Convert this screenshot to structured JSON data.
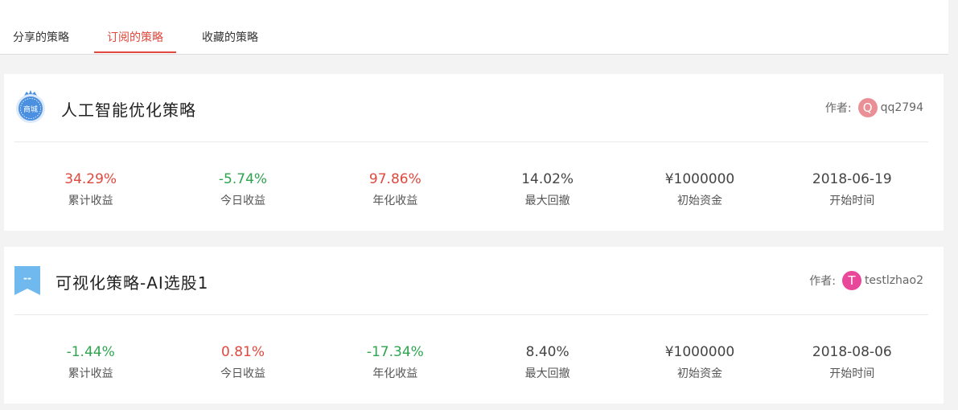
{
  "tabs": [
    {
      "label": "分享的策略",
      "active": false
    },
    {
      "label": "订阅的策略",
      "active": true
    },
    {
      "label": "收藏的策略",
      "active": false
    }
  ],
  "colors": {
    "accent": "#e0483d",
    "up": "#e0483d",
    "down": "#2ea44f"
  },
  "strategies": [
    {
      "title": "人工智能优化策略",
      "icon": "mall-badge-icon",
      "icon_text": "商城",
      "author_label": "作者:",
      "author_initial": "Q",
      "author_name": "qq2794",
      "author_color": "#ea8f96",
      "stats": [
        {
          "value": "34.29%",
          "label": "累计收益",
          "trend": "up"
        },
        {
          "value": "-5.74%",
          "label": "今日收益",
          "trend": "down"
        },
        {
          "value": "97.86%",
          "label": "年化收益",
          "trend": "up"
        },
        {
          "value": "14.02%",
          "label": "最大回撤",
          "trend": "neutral"
        },
        {
          "value": "¥1000000",
          "label": "初始资金",
          "trend": "neutral"
        },
        {
          "value": "2018-06-19",
          "label": "开始时间",
          "trend": "neutral"
        }
      ]
    },
    {
      "title": "可视化策略-AI选股1",
      "icon": "bookmark-icon",
      "icon_text": "--",
      "author_label": "作者:",
      "author_initial": "T",
      "author_name": "testlzhao2",
      "author_color": "#e8479a",
      "stats": [
        {
          "value": "-1.44%",
          "label": "累计收益",
          "trend": "down"
        },
        {
          "value": "0.81%",
          "label": "今日收益",
          "trend": "up"
        },
        {
          "value": "-17.34%",
          "label": "年化收益",
          "trend": "down"
        },
        {
          "value": "8.40%",
          "label": "最大回撤",
          "trend": "neutral"
        },
        {
          "value": "¥1000000",
          "label": "初始资金",
          "trend": "neutral"
        },
        {
          "value": "2018-08-06",
          "label": "开始时间",
          "trend": "neutral"
        }
      ]
    }
  ]
}
